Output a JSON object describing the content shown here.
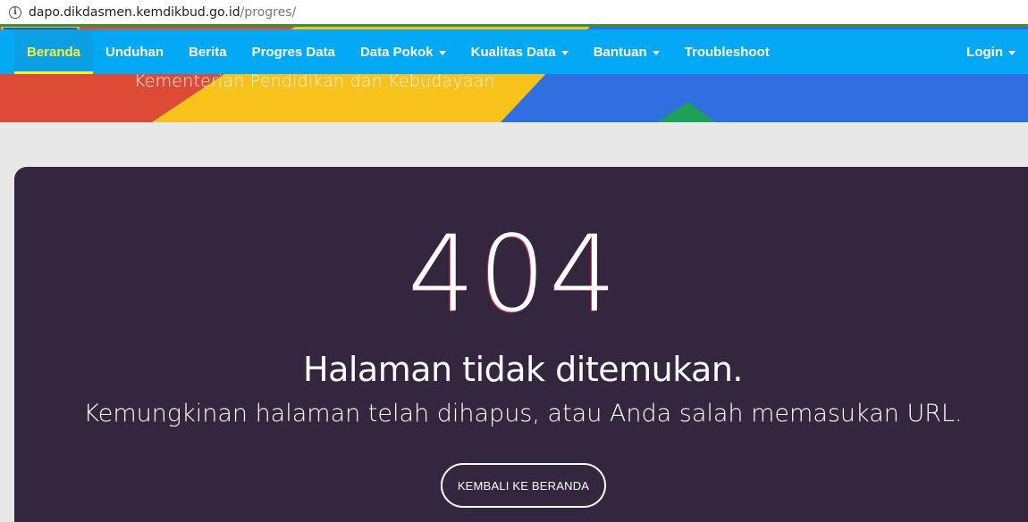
{
  "browser": {
    "url_host": "dapo.dikdasmen.kemdikbud.go.id",
    "url_path": "/progres/",
    "info_icon": "info-icon"
  },
  "banner": {
    "subtitle": "Kementerian Pendidikan dan Kebudayaan"
  },
  "nav": {
    "items": [
      {
        "label": "Beranda",
        "active": true
      },
      {
        "label": "Unduhan"
      },
      {
        "label": "Berita"
      },
      {
        "label": "Progres Data"
      },
      {
        "label": "Data Pokok",
        "dropdown": true
      },
      {
        "label": "Kualitas Data",
        "dropdown": true
      },
      {
        "label": "Bantuan",
        "dropdown": true
      },
      {
        "label": "Troubleshoot"
      }
    ],
    "login_label": "Login"
  },
  "error": {
    "code": "404",
    "title": "Halaman tidak ditemukan.",
    "description": "Kemungkinan halaman telah dihapus, atau Anda salah memasukan URL.",
    "button_label": "KEMBALI KE BERANDA"
  },
  "colors": {
    "navbar": "#03a9f4",
    "active": "#f4f43a",
    "card": "#35263f"
  }
}
